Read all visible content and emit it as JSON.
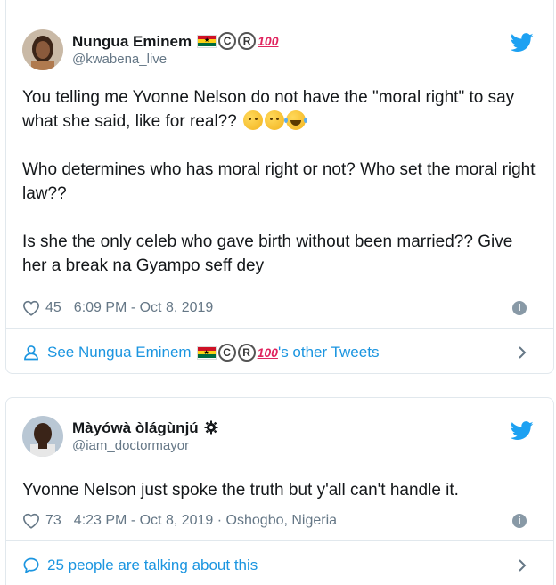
{
  "tweets": [
    {
      "display_name": "Nungua Eminem",
      "handle": "@kwabena_live",
      "paragraphs": [
        "You telling me Yvonne Nelson do not have the \"moral right\" to say what she said, like for real??",
        "Who determines who has moral right or not? Who set the moral right law??",
        "Is she the only celeb who gave birth without been married?? Give her a break na Gyampo seff dey"
      ],
      "likes": "45",
      "timestamp": "6:09 PM - Oct 8, 2019",
      "footer_prefix": "See Nungua Eminem",
      "footer_suffix": "'s other Tweets"
    },
    {
      "display_name": "Màyówà òlágùnjú",
      "handle": "@iam_doctormayor",
      "paragraphs": [
        "Yvonne Nelson just spoke the truth but y'all can't handle it."
      ],
      "likes": "73",
      "timestamp": "4:23 PM - Oct 8, 2019",
      "location": " · Oshogbo, Nigeria",
      "footer_text": "25 people are talking about this"
    }
  ],
  "badges": {
    "copyright": "C",
    "registered": "R",
    "hundred": "100",
    "info": "i"
  },
  "colors": {
    "link": "#1b95e0",
    "muted": "#657786",
    "border": "#e1e8ed",
    "twitter_blue": "#1da1f2"
  }
}
